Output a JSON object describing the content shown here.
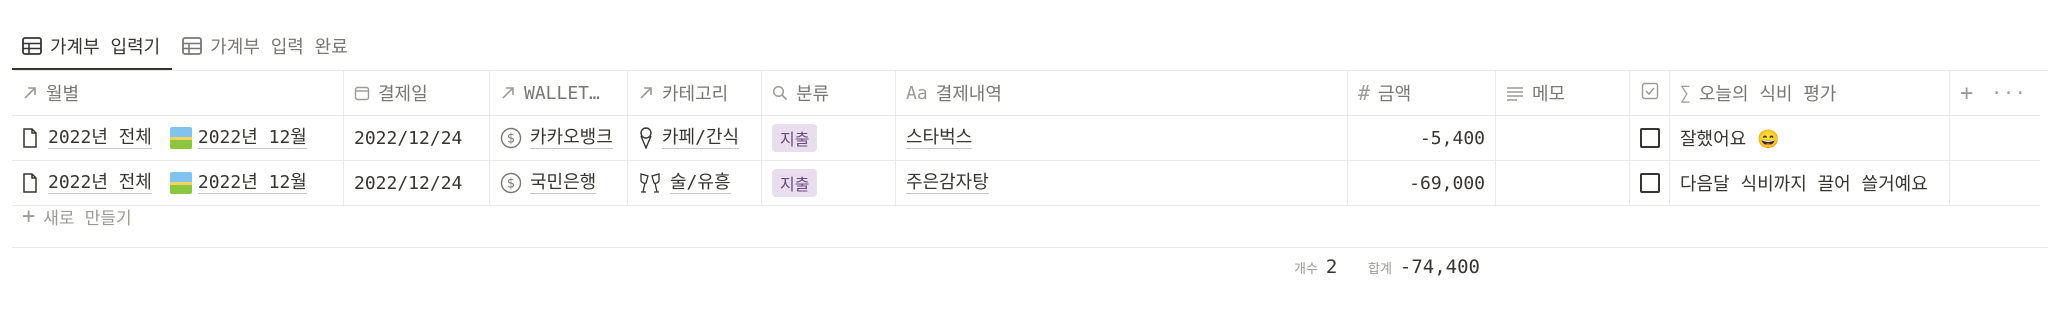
{
  "tabs": [
    {
      "label": "가계부 입력기",
      "active": true
    },
    {
      "label": "가계부 입력 완료",
      "active": false
    }
  ],
  "columns": [
    {
      "label": "월별",
      "icon": "arrow-up-right-icon"
    },
    {
      "label": "결제일",
      "icon": "calendar-icon"
    },
    {
      "label": "WALLET…",
      "icon": "arrow-up-right-icon"
    },
    {
      "label": "카테고리",
      "icon": "arrow-up-right-icon"
    },
    {
      "label": "분류",
      "icon": "search-icon"
    },
    {
      "label": "결제내역",
      "icon": "text-icon",
      "icon_text": "Aa"
    },
    {
      "label": "금액",
      "icon": "hash-icon",
      "icon_text": "#"
    },
    {
      "label": "메모",
      "icon": "lines-icon"
    },
    {
      "label": "",
      "icon": "checkbox-icon"
    },
    {
      "label": "오늘의 식비 평가",
      "icon": "sigma-icon",
      "icon_text": "∑"
    }
  ],
  "add_column_label": "+",
  "more_label": "···",
  "rows": [
    {
      "month_year": "2022년 전체",
      "month": "2022년 12월",
      "date": "2022/12/24",
      "wallet": "카카오뱅크",
      "category": "카페/간식",
      "type": "지출",
      "description": "스타벅스",
      "amount": "-5,400",
      "memo": "",
      "checked": false,
      "evaluation": "잘했어요 😄"
    },
    {
      "month_year": "2022년 전체",
      "month": "2022년 12월",
      "date": "2022/12/24",
      "wallet": "국민은행",
      "category": "술/유흥",
      "type": "지출",
      "description": "주은감자탕",
      "amount": "-69,000",
      "memo": "",
      "checked": false,
      "evaluation": "다음달 식비까지 끌어 쓸거예요"
    }
  ],
  "new_row_label": "새로 만들기",
  "footer": {
    "count_label": "개수",
    "count_value": "2",
    "sum_label": "합계",
    "sum_value": "-74,400"
  },
  "colors": {
    "tag_bg": "#e8deee",
    "tag_text": "#6b4a82",
    "border": "#e9e9e7",
    "muted": "#787774"
  }
}
